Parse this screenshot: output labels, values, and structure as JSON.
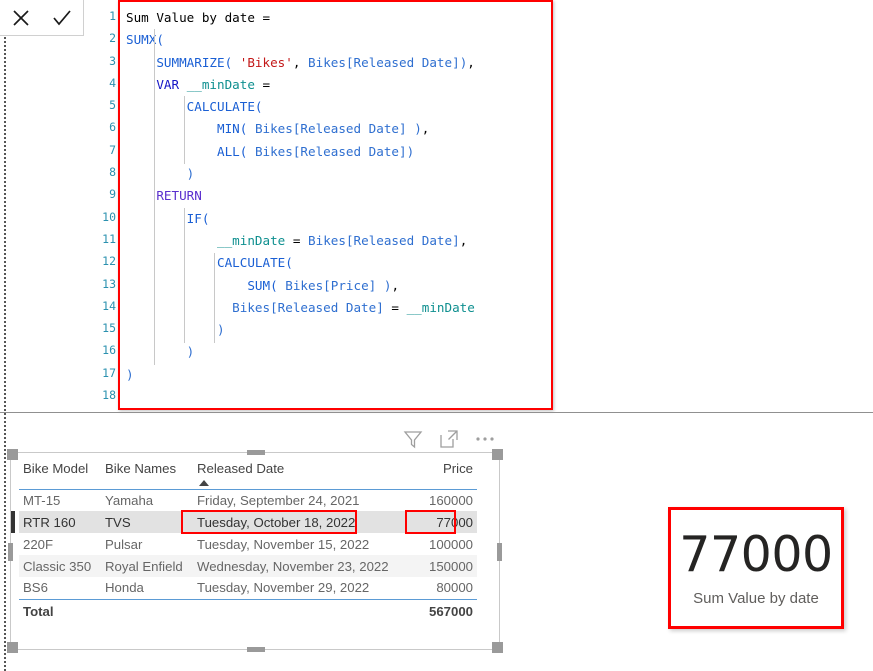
{
  "toolbar": {
    "cancel_label": "Cancel",
    "commit_label": "Commit",
    "cancel_icon": "close-icon",
    "commit_icon": "check-icon"
  },
  "formula_editor": {
    "highlight_color": "#ff0000",
    "line_numbers": [
      "1",
      "2",
      "3",
      "4",
      "5",
      "6",
      "7",
      "8",
      "9",
      "10",
      "11",
      "12",
      "13",
      "14",
      "15",
      "16",
      "17",
      "18"
    ],
    "measure_name": "Sum Value by date",
    "lines": [
      {
        "n": "1",
        "text": "Sum Value by date ="
      },
      {
        "n": "2",
        "text": "SUMX("
      },
      {
        "n": "3",
        "text": "    SUMMARIZE( 'Bikes', Bikes[Released Date]),"
      },
      {
        "n": "4",
        "text": "    VAR __minDate ="
      },
      {
        "n": "5",
        "text": "        CALCULATE("
      },
      {
        "n": "6",
        "text": "            MIN( Bikes[Released Date] ),"
      },
      {
        "n": "7",
        "text": "            ALL( Bikes[Released Date])"
      },
      {
        "n": "8",
        "text": "        )"
      },
      {
        "n": "9",
        "text": "    RETURN"
      },
      {
        "n": "10",
        "text": "        IF("
      },
      {
        "n": "11",
        "text": "            __minDate = Bikes[Released Date],"
      },
      {
        "n": "12",
        "text": "            CALCULATE("
      },
      {
        "n": "13",
        "text": "                SUM( Bikes[Price] ),"
      },
      {
        "n": "14",
        "text": "              Bikes[Released Date] = __minDate"
      },
      {
        "n": "15",
        "text": "            )"
      },
      {
        "n": "16",
        "text": "        )"
      },
      {
        "n": "17",
        "text": ")"
      },
      {
        "n": "18",
        "text": ""
      }
    ]
  },
  "visual_toolbar": {
    "filter_icon": "filter-icon",
    "focus_icon": "focus-mode-icon",
    "more_icon": "more-options-icon",
    "filter_label": "Filters",
    "focus_label": "Focus mode",
    "more_label": "More options"
  },
  "table_visual": {
    "columns": [
      "Bike Model",
      "Bike Names",
      "Released Date",
      "Price"
    ],
    "sorted_column": "Released Date",
    "sort_direction": "ascending",
    "rows": [
      {
        "model": "MT-15",
        "name": "Yamaha",
        "date": "Friday, September 24, 2021",
        "price": "160000"
      },
      {
        "model": "RTR 160",
        "name": "TVS",
        "date": "Tuesday, October 18, 2022",
        "price": "77000"
      },
      {
        "model": "220F",
        "name": "Pulsar",
        "date": "Tuesday, November 15, 2022",
        "price": "100000"
      },
      {
        "model": "Classic 350",
        "name": "Royal Enfield",
        "date": "Wednesday, November 23, 2022",
        "price": "150000"
      },
      {
        "model": "BS6",
        "name": "Honda",
        "date": "Tuesday, November 29, 2022",
        "price": "80000"
      }
    ],
    "total_label": "Total",
    "total_value": "567000",
    "selected_row_index": 1
  },
  "card_visual": {
    "value": "77000",
    "label": "Sum Value by date",
    "highlight_color": "#ff0000"
  }
}
